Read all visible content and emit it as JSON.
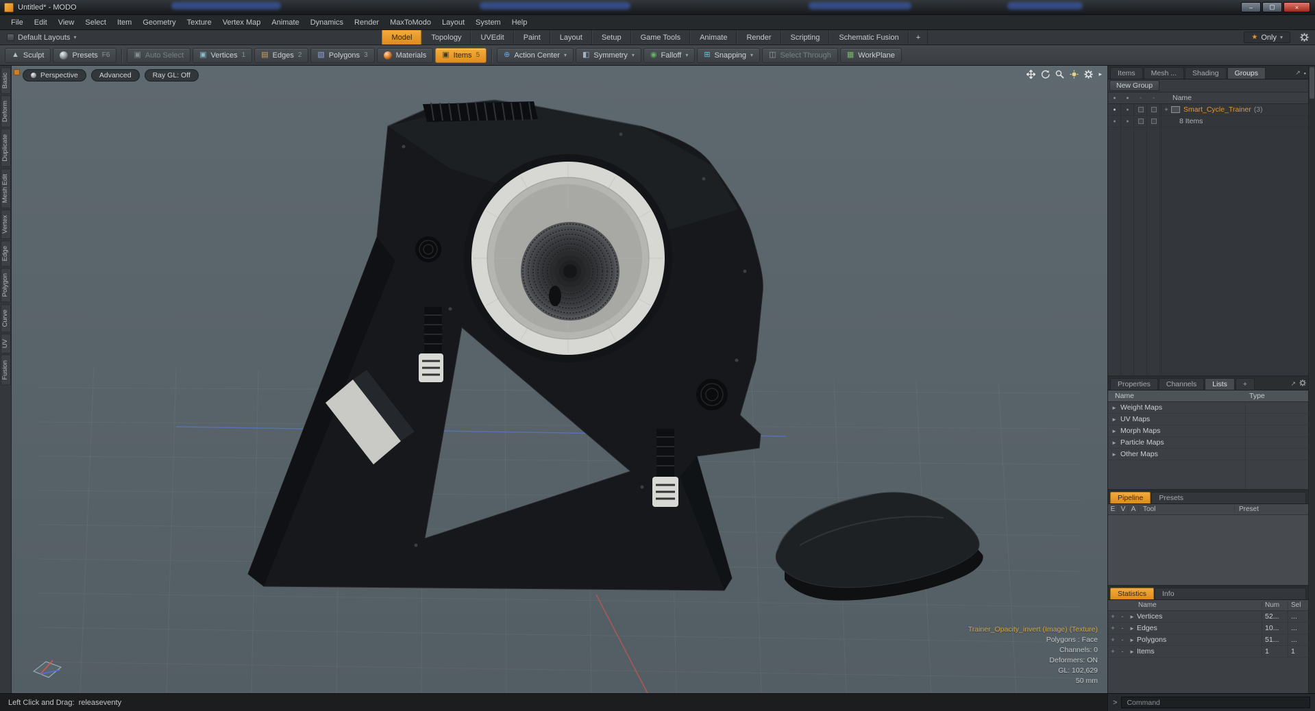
{
  "window": {
    "title": "Untitled* - MODO",
    "controls": {
      "minimize": "–",
      "maximize": "▢",
      "close": "×"
    }
  },
  "menu": {
    "items": [
      "File",
      "Edit",
      "View",
      "Select",
      "Item",
      "Geometry",
      "Texture",
      "Vertex Map",
      "Animate",
      "Dynamics",
      "Render",
      "MaxToModo",
      "Layout",
      "System",
      "Help"
    ]
  },
  "layout_bar": {
    "layout_switcher": "Default Layouts",
    "tabs": [
      "Model",
      "Topology",
      "UVEdit",
      "Paint",
      "Layout",
      "Setup",
      "Game Tools",
      "Animate",
      "Render",
      "Scripting",
      "Schematic Fusion"
    ],
    "add_tab": "+",
    "only_button": "Only"
  },
  "toolbar": {
    "sculpt": "Sculpt",
    "presets": "Presets",
    "presets_key": "F6",
    "auto_select": "Auto Select",
    "vertices": "Vertices",
    "vertices_key": "1",
    "edges": "Edges",
    "edges_key": "2",
    "polygons": "Polygons",
    "polygons_key": "3",
    "materials": "Materials",
    "items": "Items",
    "items_key": "5",
    "action_center": "Action Center",
    "symmetry": "Symmetry",
    "falloff": "Falloff",
    "snapping": "Snapping",
    "select_through": "Select Through",
    "workplane": "WorkPlane"
  },
  "left_tabs": [
    "Basic",
    "Deform",
    "Duplicate",
    "Mesh Edit",
    "Vertex",
    "Edge",
    "Polygon",
    "Curve",
    "UV",
    "Fusion"
  ],
  "viewport": {
    "perspective": "Perspective",
    "advanced": "Advanced",
    "raygl": "Ray GL: Off",
    "info": {
      "texture": "Trainer_Opacity_invert (Image) (Texture)",
      "polygons": "Polygons : Face",
      "channels": "Channels: 0",
      "deformers": "Deformers: ON",
      "gl": "GL: 102,629",
      "grid": "50 mm"
    }
  },
  "groups_panel": {
    "tabs": [
      "Items",
      "Mesh ...",
      "Shading",
      "Groups"
    ],
    "new_group_button": "New Group",
    "name_header": "Name",
    "group_name": "Smart_Cycle_Trainer",
    "group_count": "(3)",
    "group_items": "8 Items"
  },
  "lists_panel": {
    "tabs": [
      "Properties",
      "Channels",
      "Lists"
    ],
    "add_tab": "+",
    "name_header": "Name",
    "type_header": "Type",
    "rows": [
      "Weight Maps",
      "UV Maps",
      "Morph Maps",
      "Particle Maps",
      "Other Maps"
    ]
  },
  "pipeline_panel": {
    "tab": "Pipeline",
    "presets_tab": "Presets",
    "col_e": "E",
    "col_v": "V",
    "col_a": "A",
    "col_tool": "Tool",
    "col_preset": "Preset"
  },
  "statistics_panel": {
    "tab": "Statistics",
    "info_tab": "Info",
    "name_header": "Name",
    "num_header": "Num",
    "sel_header": "Sel",
    "rows": [
      {
        "name": "Vertices",
        "num": "52...",
        "sel": "..."
      },
      {
        "name": "Edges",
        "num": "10...",
        "sel": "..."
      },
      {
        "name": "Polygons",
        "num": "51...",
        "sel": "..."
      },
      {
        "name": "Items",
        "num": "1",
        "sel": "1"
      }
    ]
  },
  "command_bar": {
    "prompt": ">",
    "placeholder": "Command"
  },
  "status_bar": {
    "text": "Left Click and Drag:  releaseventy"
  },
  "colors": {
    "accent_orange": "#e8952f",
    "viewport_bg": "#59646a"
  }
}
